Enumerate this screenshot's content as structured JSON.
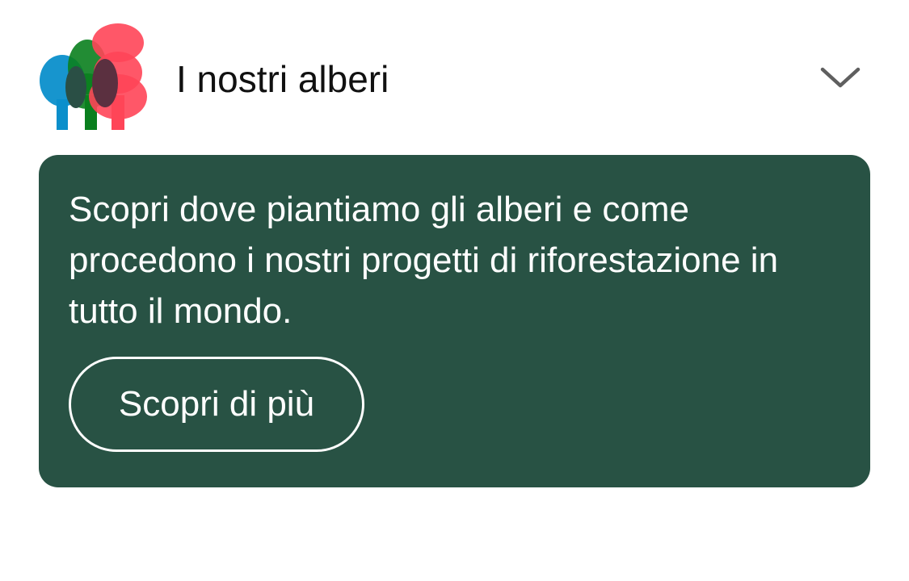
{
  "header": {
    "title": "I nostri alberi",
    "logo_icon": "trees-logo-icon",
    "toggle_icon": "chevron-down-icon"
  },
  "info": {
    "text": "Scopri dove piantiamo gli alberi e come procedono i nostri progetti di riforestazione in tutto il mondo.",
    "button_label": "Scopri di più"
  },
  "colors": {
    "panel": "#285244",
    "tree_blue": "#0B8FCB",
    "tree_green": "#0A7F1E",
    "tree_red": "#FF4558",
    "chevron": "#5F5F5F"
  }
}
